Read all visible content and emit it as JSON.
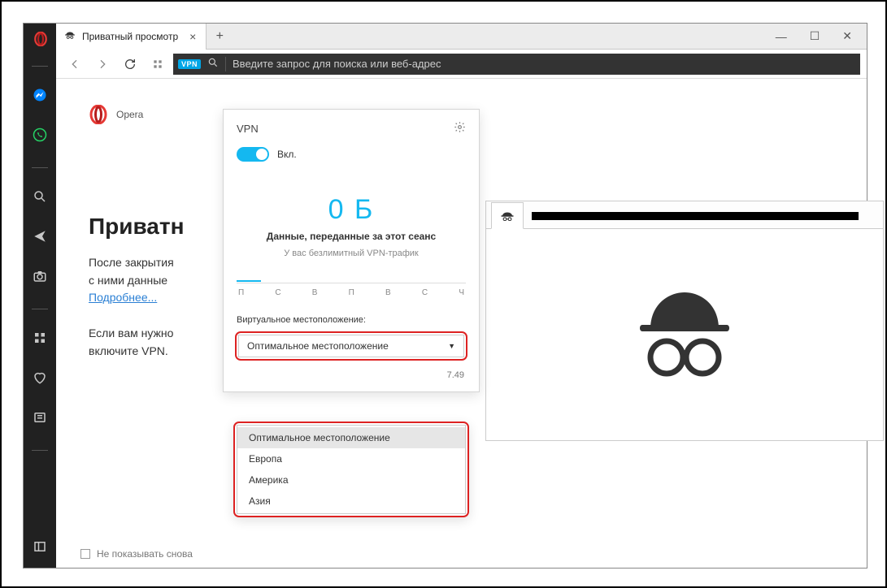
{
  "tab": {
    "title": "Приватный просмотр"
  },
  "addressbar": {
    "badge": "VPN",
    "placeholder": "Введите запрос для поиска или веб-адрес"
  },
  "brand": {
    "name": "Opera"
  },
  "page": {
    "title": "Приватн",
    "paragraph1": "После закрытия",
    "paragraph2": "с ними данные",
    "learn_more": "Подробнее...",
    "paragraph3": "Если вам нужно",
    "paragraph4": "включите VPN."
  },
  "noshow": {
    "label": "Не показывать снова"
  },
  "vpn": {
    "title": "VPN",
    "on_label": "Вкл.",
    "data_amount": "0 Б",
    "data_caption": "Данные, переданные за этот сеанс",
    "data_sub": "У вас безлимитный VPN-трафик",
    "days": [
      "П",
      "С",
      "В",
      "П",
      "В",
      "С",
      "Ч"
    ],
    "location_label": "Виртуальное местоположение:",
    "selected": "Оптимальное местоположение",
    "options": [
      "Оптимальное местоположение",
      "Европа",
      "Америка",
      "Азия"
    ],
    "ip_suffix": "7.49"
  }
}
